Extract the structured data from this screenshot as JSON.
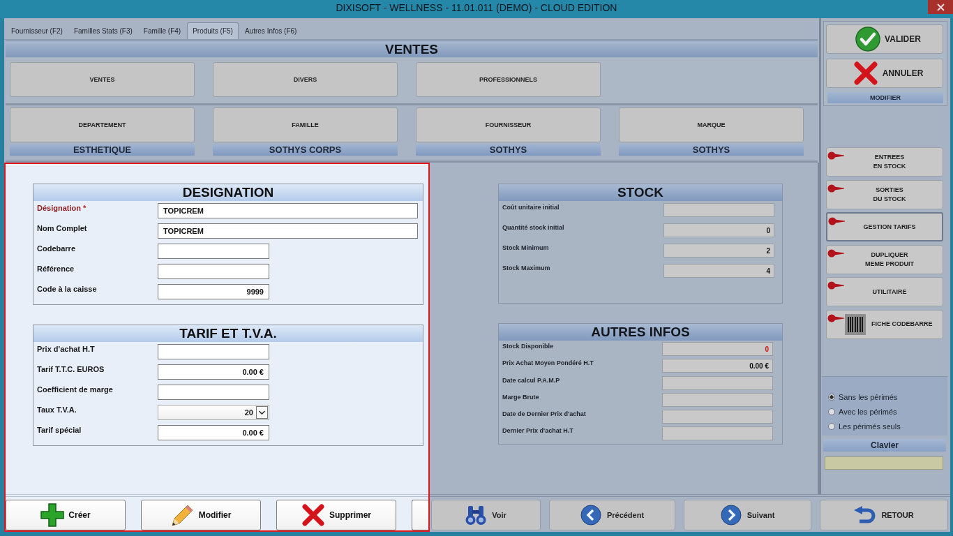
{
  "window": {
    "title": "DIXISOFT - WELLNESS - 11.01.011 (DEMO) - CLOUD EDITION"
  },
  "tabs": [
    {
      "label": "Fournisseur (F2)",
      "selected": false
    },
    {
      "label": "Familles Stats (F3)",
      "selected": false
    },
    {
      "label": "Famille (F4)",
      "selected": false
    },
    {
      "label": "Produits (F5)",
      "selected": true
    },
    {
      "label": "Autres Infos (F6)",
      "selected": false
    }
  ],
  "ventes": {
    "title": "VENTES",
    "buttons": [
      "VENTES",
      "DIVERS",
      "PROFESSIONNELS"
    ]
  },
  "classification": [
    {
      "label": "DEPARTEMENT",
      "value": "ESTHETIQUE"
    },
    {
      "label": "FAMILLE",
      "value": "SOTHYS CORPS"
    },
    {
      "label": "FOURNISSEUR",
      "value": "SOTHYS"
    },
    {
      "label": "MARQUE",
      "value": "SOTHYS"
    }
  ],
  "designation": {
    "title": "DESIGNATION",
    "fields": [
      {
        "label": "Désignation",
        "required_mark": "*",
        "kind": "long_text",
        "value": "TOPICREM"
      },
      {
        "label": "Nom Complet",
        "kind": "long_text",
        "value": "TOPICREM"
      },
      {
        "label": "Codebarre",
        "kind": "text"
      },
      {
        "label": "Référence",
        "kind": "text"
      },
      {
        "label": "Code à la caisse",
        "kind": "number",
        "value": "9999"
      }
    ]
  },
  "tarif": {
    "title": "TARIF ET T.V.A.",
    "fields": [
      {
        "label": "Prix d'achat H.T",
        "kind": "number"
      },
      {
        "label": "Tarif T.T.C. EUROS",
        "kind": "number",
        "value": "0.00 €"
      },
      {
        "label": "Coefficient de marge",
        "kind": "number"
      },
      {
        "label": "Taux T.V.A.",
        "kind": "select",
        "value": "20"
      },
      {
        "label": "Tarif spécial",
        "kind": "number",
        "value": "0.00 €"
      }
    ]
  },
  "form_actions": [
    {
      "label": "Créer"
    },
    {
      "label": "Modifier"
    },
    {
      "label": "Supprimer"
    }
  ],
  "stock": {
    "title": "STOCK",
    "fields": [
      {
        "label": "Coût unitaire initial"
      },
      {
        "label": "Quantité stock initial",
        "value": "0"
      },
      {
        "label": "Stock Minimum",
        "value": "2"
      },
      {
        "label": "Stock Maximum",
        "value": "4"
      }
    ]
  },
  "autres_infos": {
    "title": "AUTRES INFOS",
    "fields": [
      {
        "label": "Stock Disponible",
        "value": "0",
        "alert": true
      },
      {
        "label": "Prix Achat Moyen Pondéré H.T",
        "value": "0.00 €",
        "alert": false
      },
      {
        "label": "Date calcul P.A.M.P"
      },
      {
        "label": "Marge Brute"
      },
      {
        "label": "Date de Dernier Prix d'achat"
      },
      {
        "label": "Dernier Prix d'achat H.T"
      }
    ]
  },
  "side": {
    "actions": [
      {
        "label": "VALIDER"
      },
      {
        "label": "ANNULER"
      }
    ],
    "mode": "MODIFIER",
    "tools": [
      {
        "label": "ENTREES\nEN STOCK",
        "kind": "plain",
        "focused": false
      },
      {
        "label": "SORTIES\nDU STOCK",
        "kind": "plain",
        "focused": false
      },
      {
        "label": "GESTION TARIFS",
        "kind": "plain",
        "focused": true
      },
      {
        "label": "DUPLIQUER\nMEME PRODUIT",
        "kind": "plain",
        "focused": false
      },
      {
        "label": "UTILITAIRE",
        "kind": "plain",
        "focused": false
      },
      {
        "label": "FICHE CODEBARRE",
        "kind": "barcode",
        "focused": false
      }
    ],
    "stock_filter": [
      {
        "label": "Sans les périmés",
        "selected": true
      },
      {
        "label": "Avec les périmés",
        "selected": false
      },
      {
        "label": "Les périmés seuls",
        "selected": false
      }
    ],
    "keyboard": {
      "title": "Clavier"
    }
  },
  "navigation": [
    {
      "label": "Voir"
    },
    {
      "label": "Précédent"
    },
    {
      "label": "Suivant"
    },
    {
      "label": "RETOUR"
    }
  ]
}
